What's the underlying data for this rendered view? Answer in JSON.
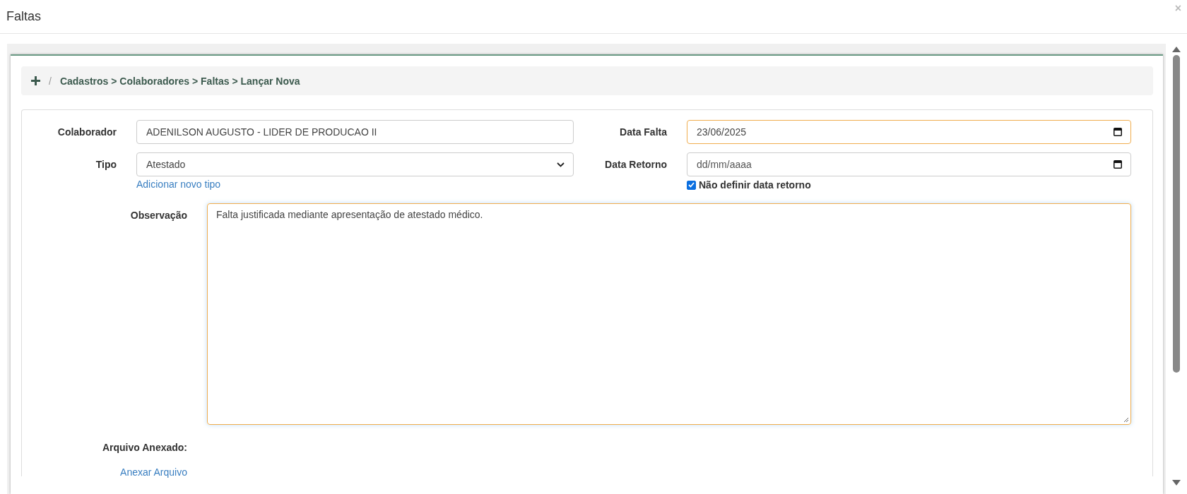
{
  "window": {
    "title": "Faltas",
    "close": "×"
  },
  "breadcrumb": {
    "separator": "/",
    "path": "Cadastros > Colaboradores > Faltas > Lançar Nova"
  },
  "form": {
    "colaborador": {
      "label": "Colaborador",
      "value": "ADENILSON AUGUSTO - LIDER DE PRODUCAO II",
      "highlighted": false
    },
    "data_falta": {
      "label": "Data Falta",
      "value": "23/06/2025",
      "highlighted": true
    },
    "tipo": {
      "label": "Tipo",
      "value": "Atestado",
      "link": "Adicionar novo tipo"
    },
    "data_retorno": {
      "label": "Data Retorno",
      "placeholder": "dd/mm/aaaa",
      "highlighted": false
    },
    "nao_definir": {
      "label": "Não definir data retorno",
      "checked": true
    },
    "observacao": {
      "label": "Observação",
      "value": "Falta justificada mediante apresentação de atestado médico.",
      "highlighted": true
    },
    "arquivo": {
      "label": "Arquivo Anexado:",
      "link": "Anexar Arquivo"
    }
  }
}
